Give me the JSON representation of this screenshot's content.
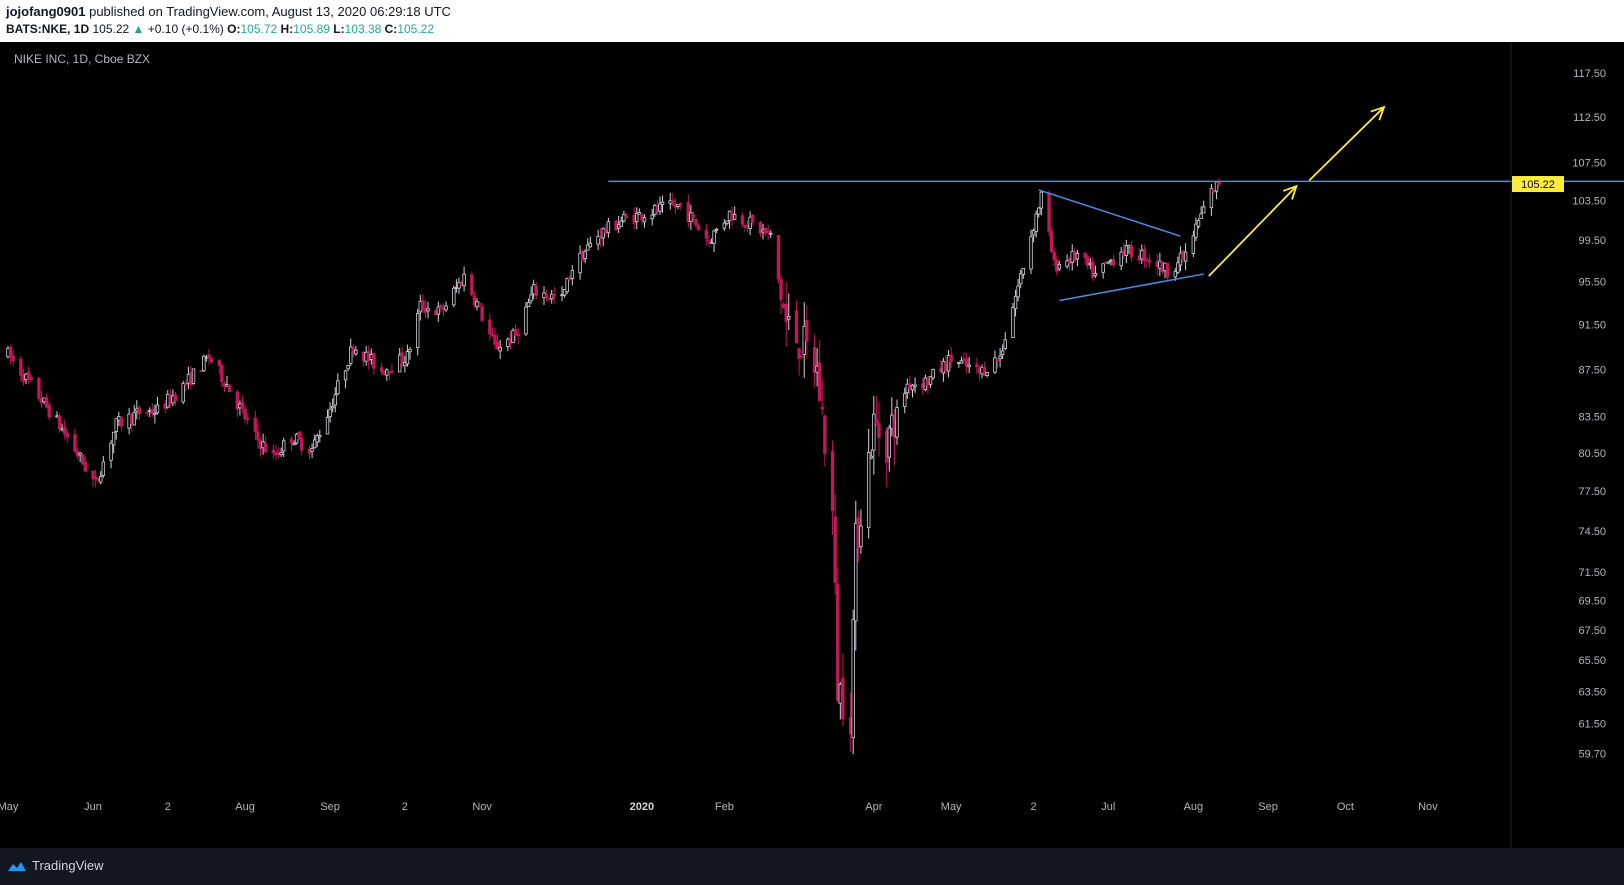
{
  "header": {
    "author": "jojofang0901",
    "published_text": "published on TradingView.com, August 13, 2020 06:29:18 UTC",
    "symbol": "BATS:NKE, 1D",
    "last": "105.22",
    "change_arrow": "▲",
    "change": "+0.10 (+0.1%)",
    "o_label": "O:",
    "o_val": "105.72",
    "h_label": "H:",
    "h_val": "105.89",
    "l_label": "L:",
    "l_val": "103.38",
    "c_label": "C:",
    "c_val": "105.22"
  },
  "footer": {
    "brand": "TradingView"
  },
  "colors": {
    "up": "#d1d4dc",
    "down": "#c2185b",
    "resistance": "#4a90e2",
    "triangle": "#4a90e2",
    "arrow": "#ffeb3b",
    "price_tag": "#ffeb3b"
  },
  "chart_data": {
    "type": "candlestick",
    "title": "NIKE INC, 1D, Cboe BZX",
    "y_ticks": [
      117.5,
      112.5,
      107.5,
      103.5,
      99.5,
      95.5,
      91.5,
      87.5,
      83.5,
      80.5,
      77.5,
      74.5,
      71.5,
      69.5,
      67.5,
      65.5,
      63.5,
      61.5,
      59.7
    ],
    "y_tick_labels": [
      "117.50",
      "112.50",
      "107.50",
      "103.50",
      "99.50",
      "95.50",
      "91.50",
      "87.50",
      "83.50",
      "80.50",
      "77.50",
      "74.50",
      "71.50",
      "69.50",
      "67.50",
      "65.50",
      "63.50",
      "61.50",
      "59.70"
    ],
    "log_scale": true,
    "ylim": [
      58.6,
      120.0
    ],
    "x_labels": [
      "May",
      "Jun",
      "2",
      "Aug",
      "Sep",
      "2",
      "Nov",
      "2020",
      "Feb",
      "Apr",
      "May",
      "2",
      "Jul",
      "Aug",
      "Sep",
      "Oct",
      "Nov"
    ],
    "x_range": [
      "2019-05-01",
      "2020-11-30"
    ],
    "x_label_dates": [
      "2019-05-01",
      "2019-06-03",
      "2019-07-02",
      "2019-08-01",
      "2019-09-03",
      "2019-10-02",
      "2019-11-01",
      "2020-01-02",
      "2020-02-03",
      "2020-04-01",
      "2020-05-01",
      "2020-06-02",
      "2020-07-01",
      "2020-08-03",
      "2020-09-01",
      "2020-10-01",
      "2020-11-02"
    ],
    "bold_x_labels": [
      "2020"
    ],
    "current_price": "105.22",
    "resistance": {
      "price": 105.5,
      "from": "2019-12-20",
      "to": "2020-11-30"
    },
    "triangle": {
      "upper": [
        {
          "date": "2020-06-04",
          "price": 104.6
        },
        {
          "date": "2020-07-29",
          "price": 99.9
        }
      ],
      "lower": [
        {
          "date": "2020-06-12",
          "price": 93.7
        },
        {
          "date": "2020-08-07",
          "price": 96.2
        }
      ]
    },
    "arrows": [
      {
        "from": {
          "date": "2020-08-09",
          "price": 96.0
        },
        "to": {
          "date": "2020-09-12",
          "price": 105.0
        }
      },
      {
        "from": {
          "date": "2020-09-17",
          "price": 105.6
        },
        "to": {
          "date": "2020-10-16",
          "price": 113.6
        }
      }
    ],
    "anchors": [
      [
        "2019-05-01",
        88.8
      ],
      [
        "2019-05-13",
        85.2
      ],
      [
        "2019-05-24",
        81.8
      ],
      [
        "2019-06-04",
        78.0
      ],
      [
        "2019-06-12",
        82.8
      ],
      [
        "2019-06-21",
        83.8
      ],
      [
        "2019-06-28",
        84.0
      ],
      [
        "2019-07-08",
        86.0
      ],
      [
        "2019-07-18",
        88.6
      ],
      [
        "2019-07-25",
        86.2
      ],
      [
        "2019-08-05",
        81.8
      ],
      [
        "2019-08-12",
        80.2
      ],
      [
        "2019-08-19",
        81.8
      ],
      [
        "2019-08-27",
        80.8
      ],
      [
        "2019-09-03",
        84.2
      ],
      [
        "2019-09-12",
        89.6
      ],
      [
        "2019-09-23",
        87.4
      ],
      [
        "2019-10-03",
        88.6
      ],
      [
        "2019-10-08",
        93.2
      ],
      [
        "2019-10-16",
        92.6
      ],
      [
        "2019-10-25",
        96.0
      ],
      [
        "2019-10-30",
        93.4
      ],
      [
        "2019-11-06",
        89.4
      ],
      [
        "2019-11-14",
        90.5
      ],
      [
        "2019-11-21",
        94.6
      ],
      [
        "2019-12-02",
        93.8
      ],
      [
        "2019-12-06",
        96.8
      ],
      [
        "2019-12-16",
        100.0
      ],
      [
        "2019-12-26",
        101.6
      ],
      [
        "2020-01-09",
        102.6
      ],
      [
        "2020-01-17",
        103.0
      ],
      [
        "2020-01-28",
        99.5
      ],
      [
        "2020-02-05",
        102.2
      ],
      [
        "2020-02-13",
        101.2
      ],
      [
        "2020-02-21",
        99.8
      ],
      [
        "2020-02-27",
        91.5
      ],
      [
        "2020-03-04",
        89.8
      ],
      [
        "2020-03-10",
        87.4
      ],
      [
        "2020-03-16",
        75.6
      ],
      [
        "2020-03-18",
        63.8
      ],
      [
        "2020-03-23",
        62.2
      ],
      [
        "2020-03-25",
        73.5
      ],
      [
        "2020-04-01",
        82.8
      ],
      [
        "2020-04-06",
        81.5
      ],
      [
        "2020-04-14",
        86.2
      ],
      [
        "2020-04-22",
        86.5
      ],
      [
        "2020-05-01",
        88.4
      ],
      [
        "2020-05-12",
        87.2
      ],
      [
        "2020-05-20",
        88.6
      ],
      [
        "2020-05-27",
        95.0
      ],
      [
        "2020-06-05",
        104.0
      ],
      [
        "2020-06-10",
        97.0
      ],
      [
        "2020-06-19",
        98.0
      ],
      [
        "2020-06-26",
        96.0
      ],
      [
        "2020-07-06",
        98.5
      ],
      [
        "2020-07-15",
        98.0
      ],
      [
        "2020-07-24",
        96.5
      ],
      [
        "2020-07-31",
        98.0
      ],
      [
        "2020-08-06",
        102.0
      ],
      [
        "2020-08-10",
        104.4
      ],
      [
        "2020-08-13",
        105.22
      ]
    ]
  }
}
